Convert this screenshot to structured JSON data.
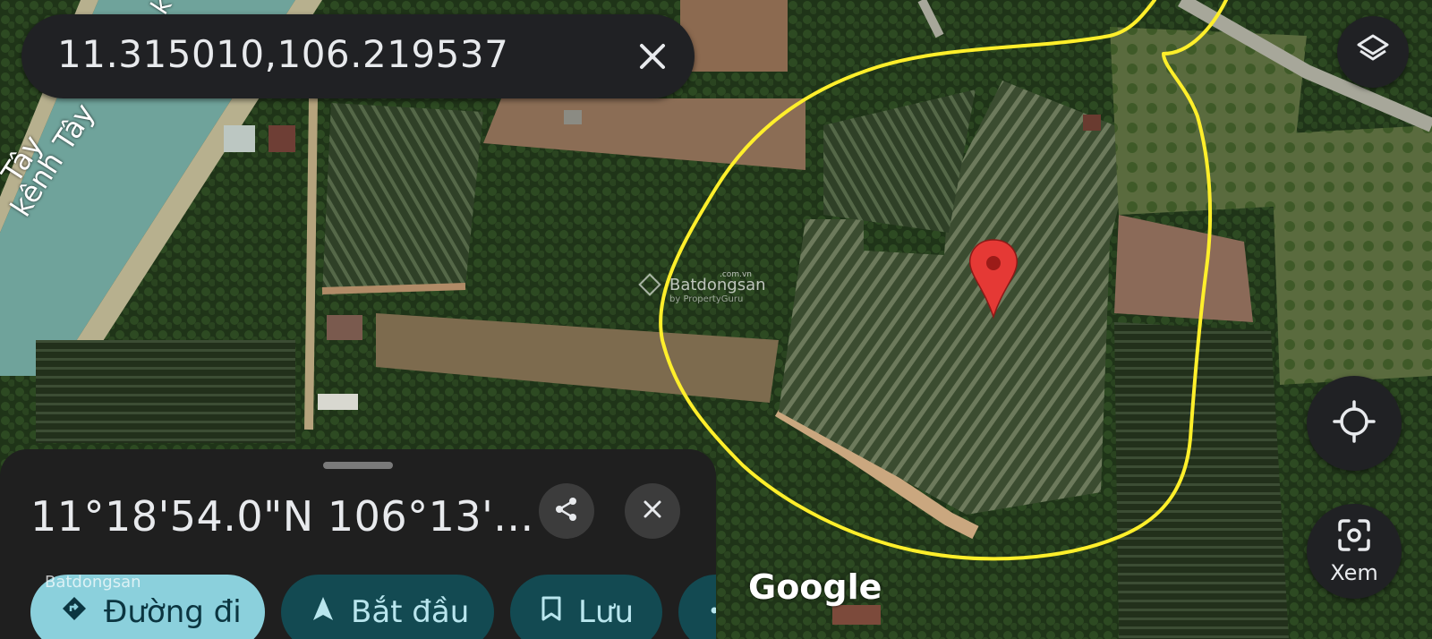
{
  "search": {
    "query": "11.315010,106.219537",
    "close_icon": "close-icon"
  },
  "map": {
    "labels": {
      "canal_name": "kênh Tây",
      "canal_name_edge": "Tây",
      "canal_name_top": "k"
    },
    "attribution": "Google",
    "watermark": {
      "brand": "Batdongsan",
      "domain": ".com.vn",
      "tagline": "by PropertyGuru"
    },
    "boundary_color": "#ffef2b",
    "pin_color": "#e53935"
  },
  "controls": {
    "layers_icon": "layers-icon",
    "locate_icon": "my-location-icon",
    "lens_label": "Xem",
    "lens_icon": "google-lens-icon"
  },
  "place_sheet": {
    "coordinates": "11°18'54.0\"N 106°13'...",
    "share_icon": "share-icon",
    "close_icon": "close-icon",
    "actions": [
      {
        "label": "Đường đi",
        "icon": "directions-icon"
      },
      {
        "label": "Bắt đầu",
        "icon": "navigation-arrow-icon"
      },
      {
        "label": "Lưu",
        "icon": "bookmark-icon"
      },
      {
        "label": "",
        "icon": "share-icon"
      }
    ]
  }
}
